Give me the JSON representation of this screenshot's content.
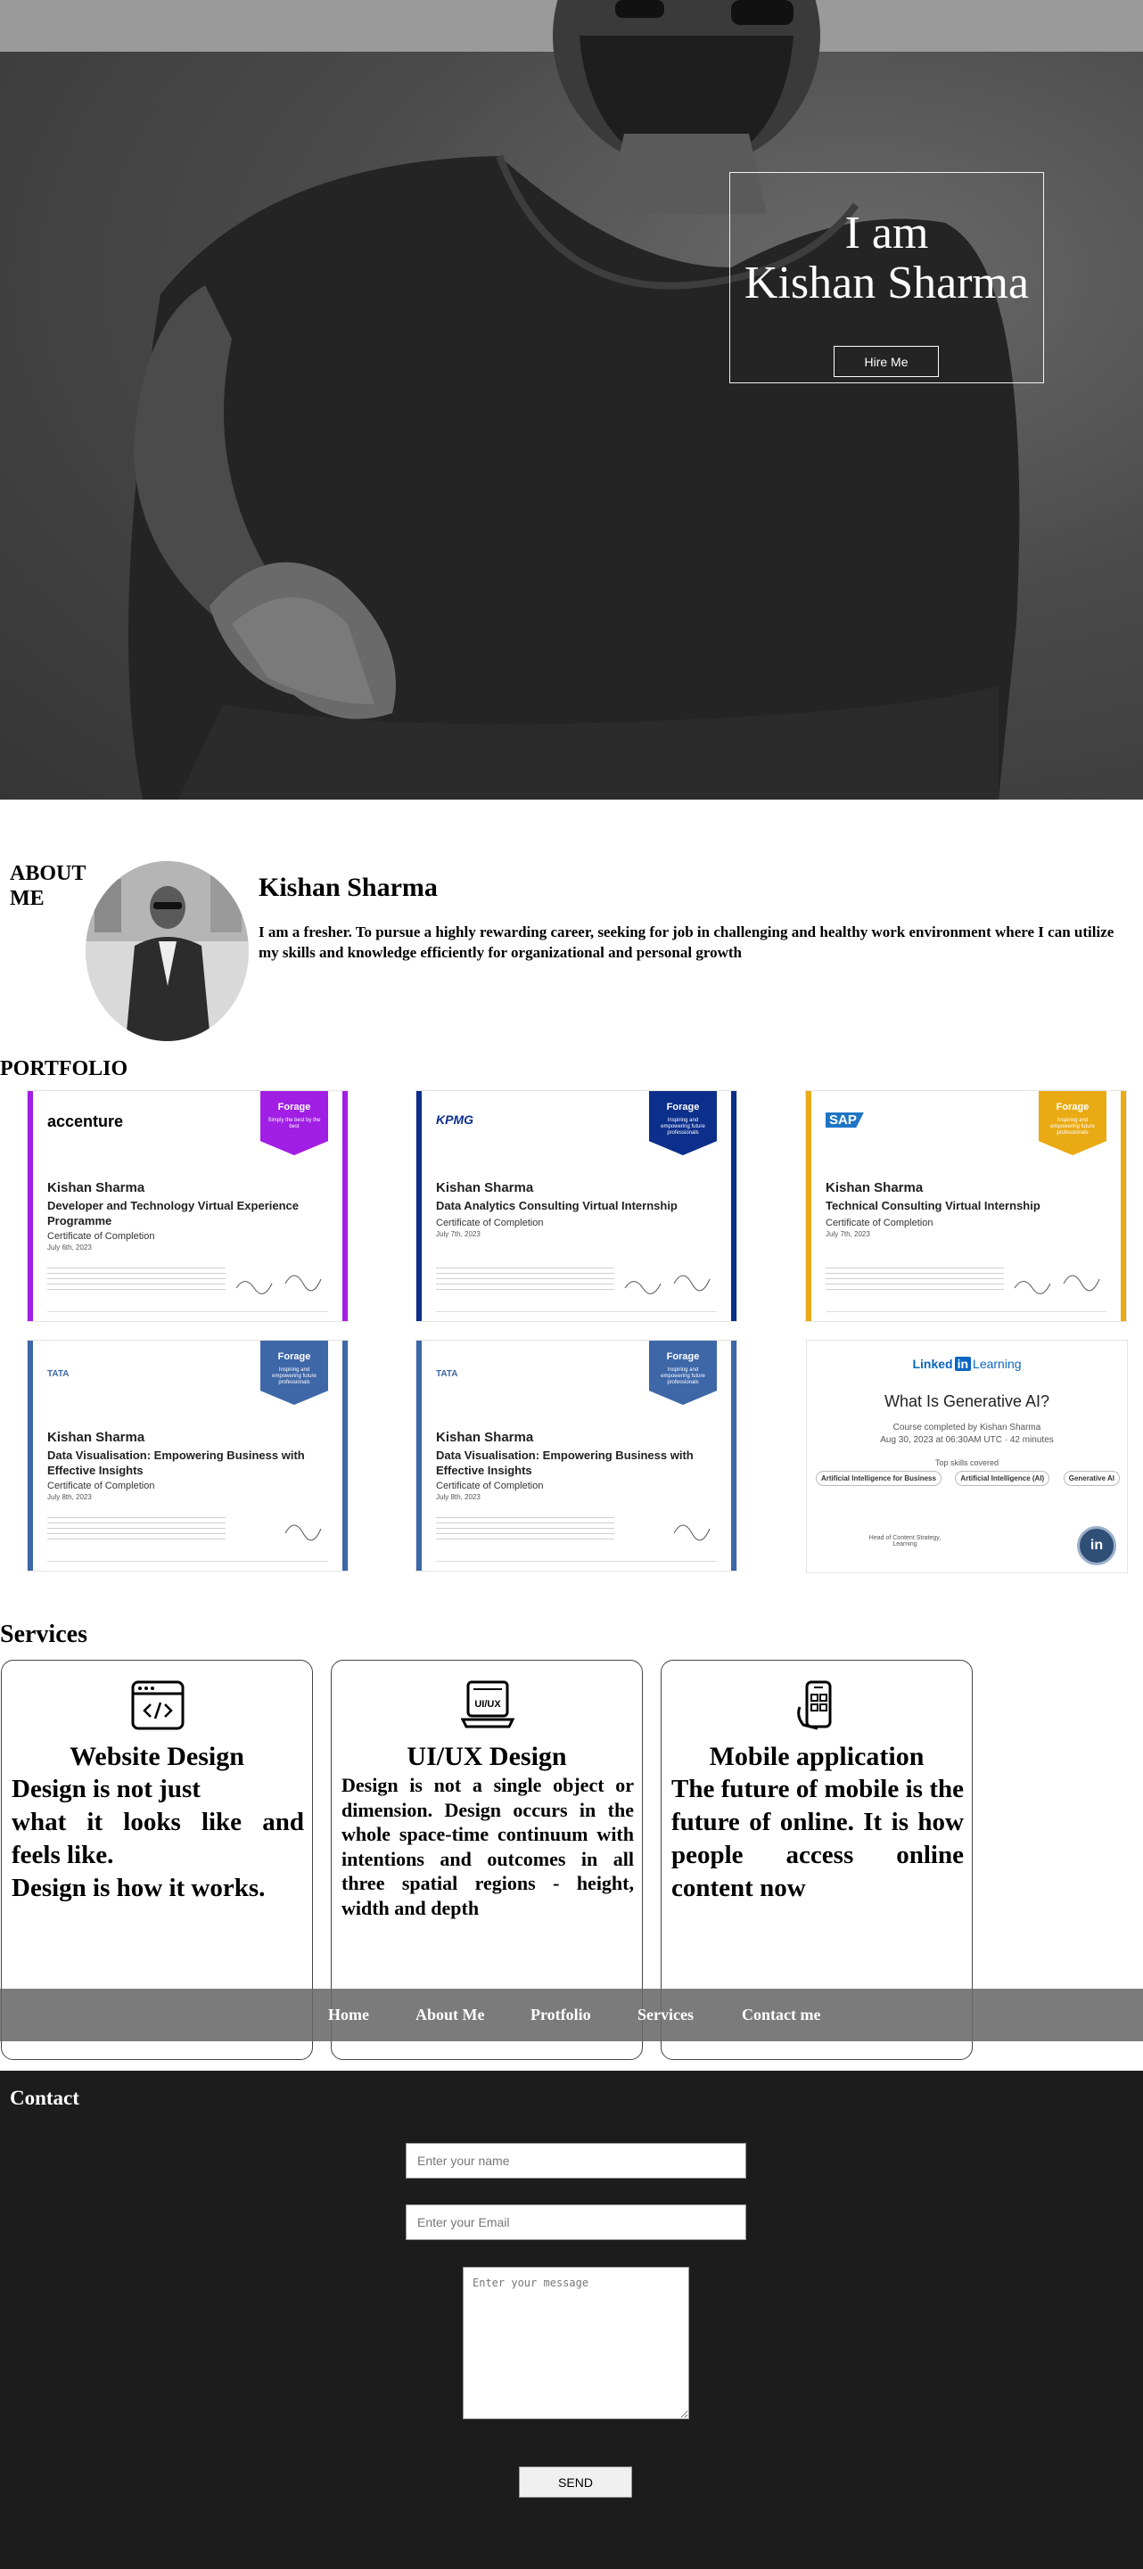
{
  "hero": {
    "line1": "I am",
    "line2": "Kishan Sharma",
    "hire_label": "Hire Me"
  },
  "about": {
    "title": "ABOUT ME",
    "name": "Kishan Sharma",
    "text": "I am a fresher. To pursue a highly rewarding career, seeking for job in challenging and healthy work environment where I can utilize my skills and knowledge efficiently for organizational and personal growth"
  },
  "portfolio": {
    "title": "PORTFOLIO",
    "certificates": [
      {
        "logo": "accenture",
        "badge": "Forage",
        "badge_sub": "Simply the best by the best",
        "name": "Kishan Sharma",
        "title": "Developer and Technology Virtual Experience Programme",
        "completion": "Certificate of Completion",
        "date": "July 6th, 2023",
        "accent": "#a11ee5"
      },
      {
        "logo": "KPMG",
        "badge": "Forage",
        "badge_sub": "Inspiring and empowering future professionals",
        "name": "Kishan Sharma",
        "title": "Data Analytics Consulting Virtual Internship",
        "completion": "Certificate of Completion",
        "date": "July 7th, 2023",
        "accent": "#0c2f8c"
      },
      {
        "logo": "SAP",
        "badge": "Forage",
        "badge_sub": "Inspiring and empowering future professionals",
        "name": "Kishan Sharma",
        "title": "Technical Consulting Virtual Internship",
        "completion": "Certificate of Completion",
        "date": "July 7th, 2023",
        "accent": "#eaaa14"
      },
      {
        "logo": "TATA",
        "badge": "Forage",
        "badge_sub": "Inspiring and empowering future professionals",
        "name": "Kishan Sharma",
        "title": "Data Visualisation: Empowering Business with Effective Insights",
        "completion": "Certificate of Completion",
        "date": "July 8th, 2023",
        "accent": "#3e67a8"
      },
      {
        "logo": "TATA",
        "badge": "Forage",
        "badge_sub": "Inspiring and empowering future professionals",
        "name": "Kishan Sharma",
        "title": "Data Visualisation: Empowering Business with Effective Insights",
        "completion": "Certificate of Completion",
        "date": "July 8th, 2023",
        "accent": "#3e67a8"
      }
    ],
    "linkedin": {
      "brand_a": "Linked",
      "brand_in": "in",
      "brand_b": "Learning",
      "title": "What Is Generative AI?",
      "completed_by": "Course completed by Kishan Sharma",
      "date": "Aug 30, 2023 at 06:30AM UTC · 42 minutes",
      "top_skills": "Top skills covered",
      "skills": [
        "Artificial Intelligence for Business",
        "Artificial Intelligence (AI)",
        "Generative AI"
      ],
      "signer": "Head of Content Strategy, Learning"
    }
  },
  "services": {
    "title": "Services",
    "items": [
      {
        "title": "Website Design",
        "desc_lines": [
          "Design is not just",
          "what it looks like and",
          "feels like.",
          "Design is how it works."
        ],
        "icon": "code-window-icon"
      },
      {
        "title": "UI/UX Design",
        "desc": "Design is not a single object or dimension. Design occurs in the whole space-time continuum with intentions and outcomes in all three spatial regions - height, width and depth",
        "icon": "ui-ux-laptop-icon",
        "icon_text": "UI/UX"
      },
      {
        "title": "Mobile application",
        "desc": "The future of mobile is the future of online. It is how people access online content now",
        "icon": "mobile-app-icon"
      }
    ]
  },
  "nav": {
    "items": [
      "Home",
      "About Me",
      "Protfolio",
      "Services",
      "Contact me"
    ]
  },
  "contact": {
    "title": "Contact",
    "name_placeholder": "Enter your name",
    "email_placeholder": "Enter your Email",
    "message_placeholder": "Enter your message",
    "send_label": "SEND"
  },
  "colors": {
    "dark_bg": "#1c1c1c",
    "nav_bg": "#696969",
    "accenture": "#a11ee5",
    "kpmg": "#0c2f8c",
    "sap": "#eaaa14",
    "tata": "#3e67a8",
    "linkedin": "#0a66c2"
  }
}
